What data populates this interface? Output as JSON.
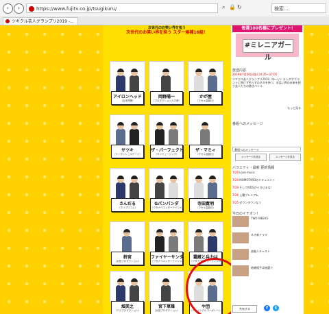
{
  "browser": {
    "url": "https://www.fujitv.co.jp/tsugikuru/",
    "search_placeholder": "検索...",
    "tab_title": "ツギクル芸人グランプリ2019 -...",
    "back_icon": "back-arrow-icon",
    "forward_icon": "forward-arrow-icon"
  },
  "header": {
    "lead_top": "次世代のお笑い界を担う",
    "lead_main": "次世代のお笑い界を担う スター候補16組！",
    "order_note": "（ネタ順）"
  },
  "entries": [
    {
      "name": "アイロンヘッド",
      "agency": "（吉本興業）"
    },
    {
      "name": "岡野陽一",
      "agency": "（プロダクション人力舎）"
    },
    {
      "name": "かが屋",
      "agency": "（マセキ芸能社）"
    },
    {
      "name": "サツキ",
      "agency": "（ケイダッシュステージ）"
    },
    {
      "name": "ザ・パーフェクト",
      "agency": "（サンミュージック）"
    },
    {
      "name": "ザ・マミィ",
      "agency": "（マセキ芸能社）"
    },
    {
      "name": "さんだる",
      "agency": "（ホリプロコム）"
    },
    {
      "name": "Gパンパンダ",
      "agency": "（ワタナベエンターテインメント）"
    },
    {
      "name": "寺田寛明",
      "agency": "（マセキ芸能社）"
    },
    {
      "name": "鈴宮",
      "agency": "（太田プロダクション）"
    },
    {
      "name": "ファイヤーサンダー",
      "agency": "（ワタナベエンターテインメント）"
    },
    {
      "name": "霜蔵と兵力は",
      "agency": "（ワタナベエンターテインメント）"
    },
    {
      "name": "畑芙之",
      "agency": "（ミスプロダクション）"
    },
    {
      "name": "宮下草薙",
      "agency": "（太田プロダクション）"
    },
    {
      "name": "や団",
      "agency": "（トゥインクルコーポレーション）"
    }
  ],
  "sidebar": {
    "banner": "毎週100名様にプレゼント!",
    "millenial_label": "#ミレニアガール",
    "broadcast_label": "放送内容",
    "broadcast_date": "2019年7月26日(金) 24:35～27:05",
    "broadcast_text": "ツギクル芸人グランプリ2019（ゆ～い）キングオブコントに負けず劣らずのネタを持つ、お笑い界の未来を担う芸人たちの熱きバトル",
    "more_link": "もっと見る",
    "message_label": "番組へのメッセージ",
    "message_select": "番組へのメッセージ",
    "msg_btn_1": "メッセージを送る",
    "msg_btn_2": "メッセージを見る",
    "news_label": "バラエティ・最新 更新情報",
    "news": [
      {
        "date": "7/29",
        "text": "Love music"
      },
      {
        "date": "7/29",
        "text": "MOMOTAROのドキュメント"
      },
      {
        "date": "7/29",
        "text": "そしてKIDSがイカせるな！"
      },
      {
        "date": "7/26",
        "text": "土曜プレミアム"
      },
      {
        "date": "7/25",
        "text": "ダウンタウンなう"
      }
    ],
    "pickup_label": "今日のイチオシ！",
    "pickups": [
      {
        "title": "TWO WEEKS"
      },
      {
        "title": "ネオ新ドラマ"
      },
      {
        "title": "芸能人キャスト"
      },
      {
        "title": "結婚相手は抽選で"
      }
    ],
    "share_label": "共有する"
  }
}
